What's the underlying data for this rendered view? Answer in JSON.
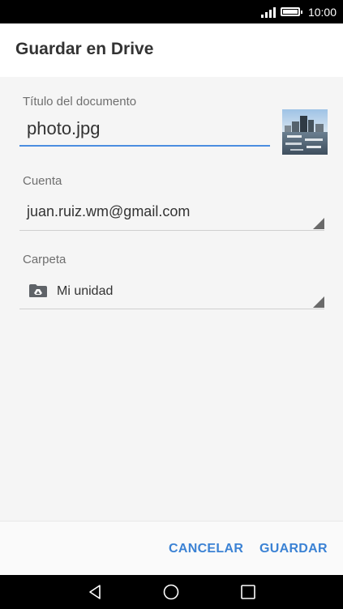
{
  "status_bar": {
    "time": "10:00",
    "icons": [
      "signal-icon",
      "battery-icon"
    ]
  },
  "header": {
    "title": "Guardar en Drive"
  },
  "form": {
    "title_label": "Título del documento",
    "title_value": "photo.jpg",
    "account_label": "Cuenta",
    "account_value": "juan.ruiz.wm@gmail.com",
    "folder_label": "Carpeta",
    "folder_value": "Mi unidad",
    "folder_icon": "drive-folder-icon"
  },
  "footer": {
    "cancel_label": "CANCELAR",
    "save_label": "GUARDAR"
  },
  "nav_bar": {
    "icons": [
      "back-icon",
      "home-icon",
      "recents-icon"
    ]
  },
  "colors": {
    "accent": "#4a8de0",
    "button_text": "#3b82d4"
  }
}
